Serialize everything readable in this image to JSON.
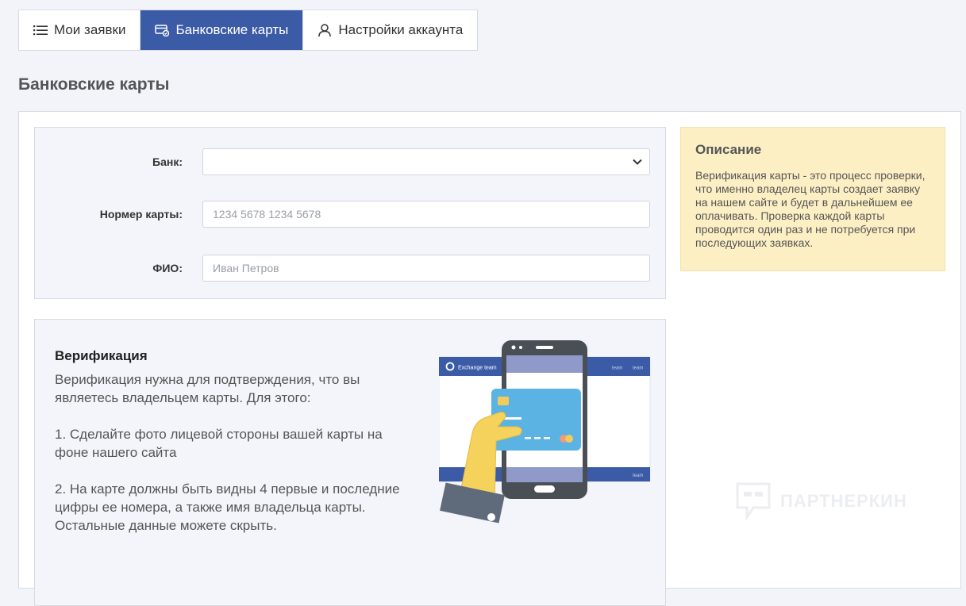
{
  "tabs": [
    {
      "label": "Мои заявки",
      "icon": "list-icon",
      "active": false
    },
    {
      "label": "Банковские карты",
      "icon": "card-icon",
      "active": true
    },
    {
      "label": "Настройки аккаунта",
      "icon": "user-icon",
      "active": false
    }
  ],
  "page_title": "Банковские карты",
  "form": {
    "bank_label": "Банк:",
    "bank_value": "",
    "card_label": "Нормер карты:",
    "card_placeholder": "1234 5678 1234 5678",
    "card_value": "",
    "name_label": "ФИО:",
    "name_placeholder": "Иван Петров",
    "name_value": ""
  },
  "description": {
    "title": "Описание",
    "text": "Верификация карты - это процесс проверки, что именно владелец карты создает заявку на нашем сайте и будет в дальнейшем ее оплачивать. Проверка каждой карты проводится один раз и не потребуется при последующих заявках."
  },
  "verification": {
    "title": "Верификация",
    "intro": "Верификация нужна для подтверждения, что вы являетесь владельцем карты. Для этого:",
    "step1": "1. Сделайте фото лицевой стороны вашей карты на фоне нашего сайта",
    "step2": "2. На карте должны быть видны 4 первые и последние цифры ее номера, а также имя владельца карты. Остальные данные можете скрыть."
  },
  "illustration": {
    "site_brand": "Exchange team",
    "nav_item_1": "team",
    "nav_item_2": "team",
    "footer_item": "team"
  },
  "watermark": {
    "text": "ПАРТНЕРКИН"
  },
  "colors": {
    "accent": "#3b5ba7",
    "description_bg": "#fdefc4",
    "page_bg": "#f2f4f9"
  }
}
